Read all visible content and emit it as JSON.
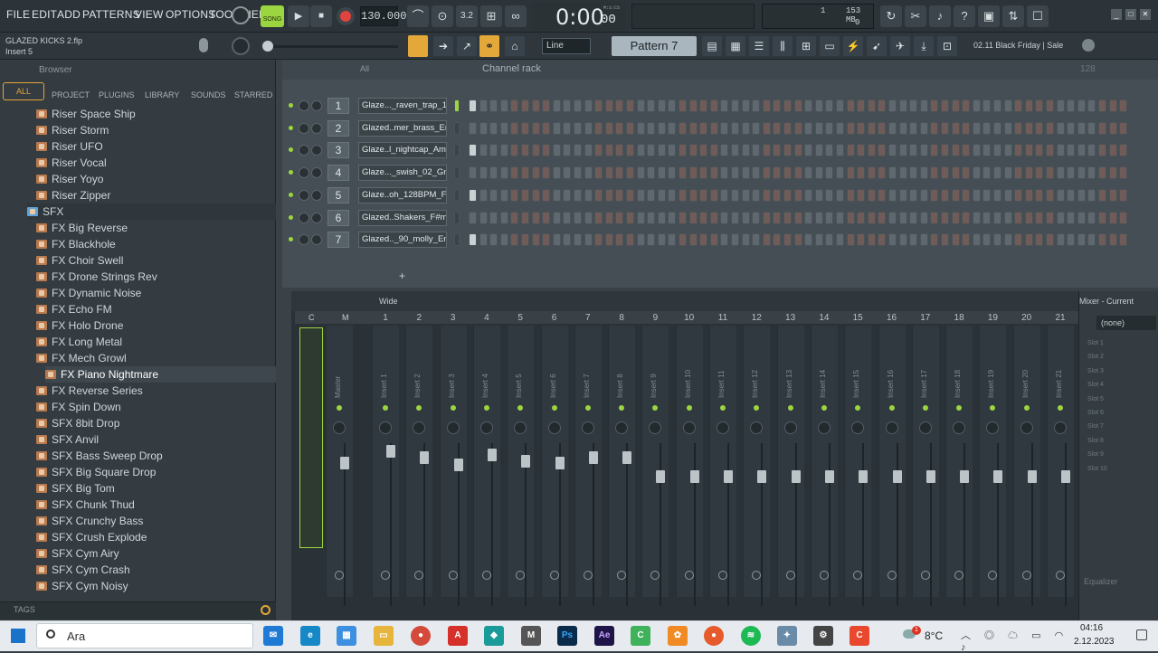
{
  "menu": [
    "FILE",
    "EDIT",
    "ADD",
    "PATTERNS",
    "VIEW",
    "OPTIONS",
    "TOOLS",
    "HELP"
  ],
  "transport": {
    "song_label": "SONG",
    "tempo": "130.000",
    "time": "0:00",
    "time_sub": "00",
    "time_unit": "M:S:CS",
    "cpu_top": "1",
    "memory": "153 MB",
    "cpu_bottom": "0"
  },
  "project": {
    "file_name": "GLAZED KICKS 2.flp",
    "focus": "Insert 5"
  },
  "toolbar2": {
    "snap": "Line",
    "pattern": "Pattern 7",
    "news": "02.11  Black Friday | Sale"
  },
  "browser": {
    "title": "Browser",
    "tabs": [
      "ALL",
      "PROJECT",
      "PLUGINS",
      "LIBRARY",
      "SOUNDS",
      "STARRED"
    ],
    "items": [
      "Riser Space Ship",
      "Riser Storm",
      "Riser UFO",
      "Riser Vocal",
      "Riser Yoyo",
      "Riser Zipper",
      "SFX",
      "FX Big Reverse",
      "FX Blackhole",
      "FX Choir Swell",
      "FX Drone Strings Rev",
      "FX Dynamic Noise",
      "FX Echo FM",
      "FX Holo Drone",
      "FX Long Metal",
      "FX Mech Growl",
      "FX Piano Nightmare",
      "FX Reverse Series",
      "FX Spin Down",
      "SFX 8bit Drop",
      "SFX Anvil",
      "SFX Bass Sweep Drop",
      "SFX Big Square Drop",
      "SFX Big Tom",
      "SFX Chunk Thud",
      "SFX Crunchy Bass",
      "SFX Crush Explode",
      "SFX Cym Airy",
      "SFX Cym Crash",
      "SFX Cym Noisy"
    ],
    "tags_label": "TAGS"
  },
  "channel_rack": {
    "title": "Channel rack",
    "filter": "All",
    "swing": "128",
    "channels": [
      {
        "num": "1",
        "name": "Glaze..._raven_trap_130"
      },
      {
        "num": "2",
        "name": "Glazed..mer_brass_Em"
      },
      {
        "num": "3",
        "name": "Glaze..l_nightcap_Amin"
      },
      {
        "num": "4",
        "name": "Glaze..._swish_02_Gmin"
      },
      {
        "num": "5",
        "name": "Glaze..oh_128BPM_Fm"
      },
      {
        "num": "6",
        "name": "Glazed..Shakers_F#min"
      },
      {
        "num": "7",
        "name": "Glazed.._90_molly_Em"
      }
    ],
    "add_label": "+"
  },
  "mixer": {
    "mode": "Wide",
    "current_title": "Mixer - Current",
    "current_value": "(none)",
    "header_c": "C",
    "header_m": "M",
    "master": "Master",
    "inserts": [
      "Insert 1",
      "Insert 2",
      "Insert 3",
      "Insert 4",
      "Insert 5",
      "Insert 6",
      "Insert 7",
      "Insert 8",
      "Insert 9",
      "Insert 10",
      "Insert 11",
      "Insert 12",
      "Insert 13",
      "Insert 14",
      "Insert 15",
      "Insert 16",
      "Insert 17",
      "Insert 18",
      "Insert 19",
      "Insert 20",
      "Insert 21"
    ],
    "numbers": [
      "1",
      "2",
      "3",
      "4",
      "5",
      "6",
      "7",
      "8",
      "9",
      "10",
      "11",
      "12",
      "13",
      "14",
      "15",
      "16",
      "17",
      "18",
      "19",
      "20",
      "21"
    ],
    "slots": [
      "Slot 1",
      "Slot 2",
      "Slot 3",
      "Slot 4",
      "Slot 5",
      "Slot 6",
      "Slot 7",
      "Slot 8",
      "Slot 9",
      "Slot 10"
    ],
    "equalizer": "Equalizer"
  },
  "taskbar": {
    "search": "Ara",
    "temp": "8°C",
    "time": "04:16",
    "date": "2.12.2023",
    "badge": "1"
  }
}
